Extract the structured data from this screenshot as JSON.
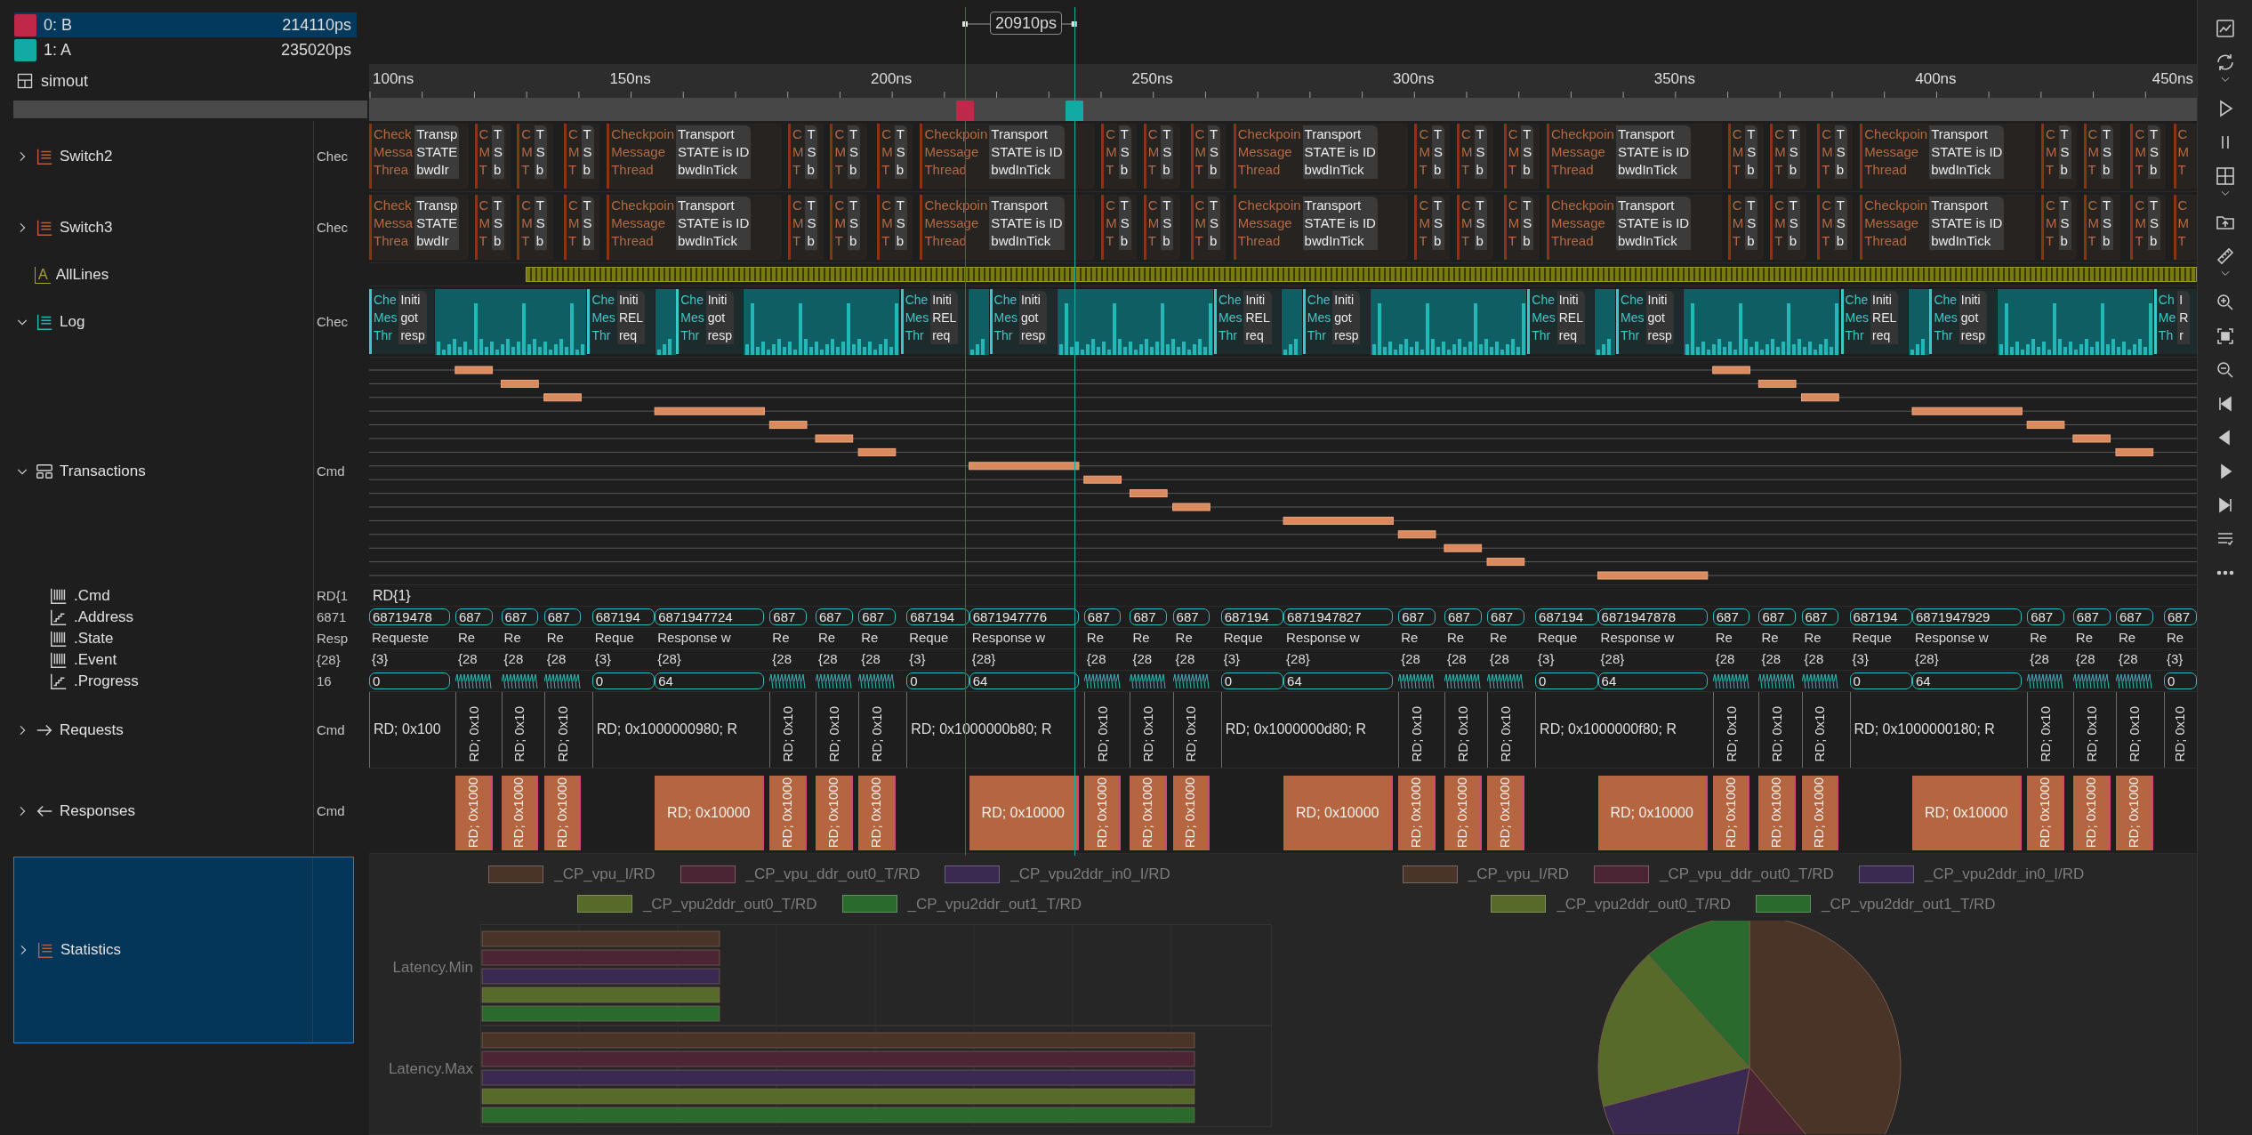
{
  "cursors": [
    {
      "label": "0: B",
      "time": "214110ps",
      "color": "#c0284a",
      "selected": true
    },
    {
      "label": "1: A",
      "time": "235020ps",
      "color": "#13aaa4",
      "selected": false
    }
  ],
  "delta": "20910ps",
  "view": {
    "title": "simout"
  },
  "ruler": [
    "100ns",
    "150ns",
    "200ns",
    "250ns",
    "300ns",
    "350ns",
    "400ns",
    "450ns"
  ],
  "tree": [
    {
      "label": "Switch2",
      "kind": "list",
      "color": "#b0603a",
      "expanded": false,
      "selected": false,
      "value": "Chec",
      "wave": {
        "kind": "blocks",
        "blocks": [
          {
            "left": [
              "Check",
              "Messa",
              "Threa"
            ],
            "right": [
              "Transp",
              "STATE",
              "bwdIr"
            ]
          },
          {
            "left": [
              "C",
              "M",
              "T"
            ],
            "right": [
              "T",
              "S",
              "b"
            ]
          },
          {
            "left": [
              "C",
              "M",
              "T"
            ],
            "right": [
              "T",
              "S",
              "b"
            ]
          },
          {
            "left": [
              "C",
              "M",
              "T"
            ],
            "right": [
              "T",
              "S",
              "b"
            ]
          },
          {
            "left": [
              "Checkpoin",
              "Message",
              "Thread"
            ],
            "right": [
              "Transport",
              "STATE is ID",
              "bwdInTick"
            ]
          },
          {
            "left": [
              "C",
              "M",
              "T"
            ],
            "right": [
              "T",
              "S",
              "b"
            ]
          },
          {
            "left": [
              "C",
              "M",
              "T"
            ],
            "right": [
              "T",
              "S",
              "b"
            ]
          },
          {
            "left": [
              "C",
              "M",
              "T"
            ],
            "right": [
              "T",
              "S",
              "b"
            ]
          },
          {
            "left": [
              "Checkpoin",
              "Message",
              "Thread"
            ],
            "right": [
              "Transport",
              "STATE is ID",
              "bwdInTick"
            ]
          },
          {
            "left": [
              "C",
              "M",
              "T"
            ],
            "right": [
              "T",
              "S",
              "b"
            ]
          },
          {
            "left": [
              "C",
              "M",
              "T"
            ],
            "right": [
              "T",
              "S",
              "b"
            ]
          },
          {
            "left": [
              "C",
              "M",
              "T"
            ],
            "right": [
              "T",
              "S",
              "b"
            ]
          },
          {
            "left": [
              "Checkpoin",
              "Message",
              "Thread"
            ],
            "right": [
              "Transport",
              "STATE is ID",
              "bwdInTick"
            ]
          },
          {
            "left": [
              "C",
              "M",
              "T"
            ],
            "right": [
              "T",
              "S",
              "b"
            ]
          },
          {
            "left": [
              "C",
              "M",
              "T"
            ],
            "right": [
              "T",
              "S",
              "b"
            ]
          },
          {
            "left": [
              "C",
              "M",
              "T"
            ],
            "right": [
              "T",
              "S",
              "b"
            ]
          },
          {
            "left": [
              "Checkpoin",
              "Message",
              "Thread"
            ],
            "right": [
              "Transport",
              "STATE is ID",
              "bwdInTick"
            ]
          },
          {
            "left": [
              "C",
              "M",
              "T"
            ],
            "right": [
              "T",
              "S",
              "b"
            ]
          },
          {
            "left": [
              "C",
              "M",
              "T"
            ],
            "right": [
              "T",
              "S",
              "b"
            ]
          },
          {
            "left": [
              "C",
              "M",
              "T"
            ],
            "right": [
              "T",
              "S",
              "b"
            ]
          },
          {
            "left": [
              "Checkpoin",
              "Message",
              "Thread"
            ],
            "right": [
              "Transport",
              "STATE is ID",
              "bwdInTick"
            ]
          },
          {
            "left": [
              "C",
              "M",
              "T"
            ],
            "right": [
              "T",
              "S",
              "b"
            ]
          },
          {
            "left": [
              "C",
              "M",
              "T"
            ],
            "right": [
              "T",
              "S",
              "b"
            ]
          },
          {
            "left": [
              "C",
              "M",
              "T"
            ],
            "right": [
              "T",
              "S",
              "b"
            ]
          },
          {
            "left": [
              "C",
              "M",
              "T"
            ]
          }
        ]
      }
    },
    {
      "label": "Switch3",
      "kind": "list",
      "color": "#b0603a",
      "expanded": false,
      "selected": false,
      "value": "Chec",
      "wave": {
        "kind": "blocks",
        "blocks": [
          {
            "left": [
              "Check",
              "Messa",
              "Threa"
            ],
            "right": [
              "Transp",
              "STATE",
              "bwdIr"
            ]
          },
          {
            "left": [
              "C",
              "M",
              "T"
            ],
            "right": [
              "T",
              "S",
              "b"
            ]
          },
          {
            "left": [
              "C",
              "M",
              "T"
            ],
            "right": [
              "T",
              "S",
              "b"
            ]
          },
          {
            "left": [
              "C",
              "M",
              "T"
            ],
            "right": [
              "T",
              "S",
              "b"
            ]
          },
          {
            "left": [
              "Checkpoin",
              "Message",
              "Thread"
            ],
            "right": [
              "Transport",
              "STATE is ID",
              "bwdInTick"
            ]
          },
          {
            "left": [
              "C",
              "M",
              "T"
            ],
            "right": [
              "T",
              "S",
              "b"
            ]
          },
          {
            "left": [
              "C",
              "M",
              "T"
            ],
            "right": [
              "T",
              "S",
              "b"
            ]
          },
          {
            "left": [
              "C",
              "M",
              "T"
            ],
            "right": [
              "T",
              "S",
              "b"
            ]
          },
          {
            "left": [
              "Checkpoin",
              "Message",
              "Thread"
            ],
            "right": [
              "Transport",
              "STATE is ID",
              "bwdInTick"
            ]
          },
          {
            "left": [
              "C",
              "M",
              "T"
            ],
            "right": [
              "T",
              "S",
              "b"
            ]
          },
          {
            "left": [
              "C",
              "M",
              "T"
            ],
            "right": [
              "T",
              "S",
              "b"
            ]
          },
          {
            "left": [
              "C",
              "M",
              "T"
            ],
            "right": [
              "T",
              "S",
              "b"
            ]
          },
          {
            "left": [
              "Checkpoin",
              "Message",
              "Thread"
            ],
            "right": [
              "Transport",
              "STATE is ID",
              "bwdInTick"
            ]
          },
          {
            "left": [
              "C",
              "M",
              "T"
            ],
            "right": [
              "T",
              "S",
              "b"
            ]
          },
          {
            "left": [
              "C",
              "M",
              "T"
            ],
            "right": [
              "T",
              "S",
              "b"
            ]
          },
          {
            "left": [
              "C",
              "M",
              "T"
            ],
            "right": [
              "T",
              "S",
              "b"
            ]
          },
          {
            "left": [
              "Checkpoin",
              "Message",
              "Thread"
            ],
            "right": [
              "Transport",
              "STATE is ID",
              "bwdInTick"
            ]
          },
          {
            "left": [
              "C",
              "M",
              "T"
            ],
            "right": [
              "T",
              "S",
              "b"
            ]
          },
          {
            "left": [
              "C",
              "M",
              "T"
            ],
            "right": [
              "T",
              "S",
              "b"
            ]
          },
          {
            "left": [
              "C",
              "M",
              "T"
            ],
            "right": [
              "T",
              "S",
              "b"
            ]
          },
          {
            "left": [
              "Checkpoin",
              "Message",
              "Thread"
            ],
            "right": [
              "Transport",
              "STATE is ID",
              "bwdInTick"
            ]
          },
          {
            "left": [
              "C",
              "M",
              "T"
            ],
            "right": [
              "T",
              "S",
              "b"
            ]
          },
          {
            "left": [
              "C",
              "M",
              "T"
            ],
            "right": [
              "T",
              "S",
              "b"
            ]
          },
          {
            "left": [
              "C",
              "M",
              "T"
            ],
            "right": [
              "T",
              "S",
              "b"
            ]
          },
          {
            "left": [
              "C",
              "M",
              "T"
            ]
          }
        ]
      }
    },
    {
      "label": "AllLines",
      "kind": "text",
      "badge": "A",
      "color": "#a8a030",
      "selected": false,
      "wave": {
        "kind": "density"
      }
    },
    {
      "label": "Log",
      "kind": "list",
      "color": "#22b8b8",
      "expanded": true,
      "selected": false,
      "value": "Chec",
      "wave": {
        "kind": "log",
        "blocks": [
          {
            "left": [
              "Che",
              "Mes",
              "Thr"
            ],
            "right": [
              "Initi",
              "got",
              "resp"
            ]
          },
          {
            "left": [
              "Che",
              "Mes",
              "Thr"
            ],
            "right": [
              "Initi",
              "REL",
              "req"
            ]
          },
          {
            "left": [
              "Che",
              "Mes",
              "Thr"
            ],
            "right": [
              "Initi",
              "got",
              "resp"
            ]
          },
          {
            "left": [
              "Che",
              "Mes",
              "Thr"
            ],
            "right": [
              "Initi",
              "REL",
              "req"
            ]
          },
          {
            "left": [
              "Che",
              "Mes",
              "Thr"
            ],
            "right": [
              "Initi",
              "got",
              "resp"
            ]
          },
          {
            "left": [
              "Che",
              "Mes",
              "Thr"
            ],
            "right": [
              "Initi",
              "REL",
              "req"
            ]
          },
          {
            "left": [
              "Che",
              "Mes",
              "Thr"
            ],
            "right": [
              "Initi",
              "got",
              "resp"
            ]
          },
          {
            "left": [
              "Che",
              "Mes",
              "Thr"
            ],
            "right": [
              "Initi",
              "REL",
              "req"
            ]
          },
          {
            "left": [
              "Che",
              "Mes",
              "Thr"
            ],
            "right": [
              "Initi",
              "got",
              "resp"
            ]
          },
          {
            "left": [
              "Che",
              "Mes",
              "Thr"
            ],
            "right": [
              "Initi",
              "REL",
              "req"
            ]
          },
          {
            "left": [
              "Che",
              "Mes",
              "Thr"
            ],
            "right": [
              "Initi",
              "got",
              "resp"
            ]
          },
          {
            "left": [
              "Ch",
              "Me",
              "Th"
            ],
            "right": [
              "I",
              "R",
              "r"
            ]
          }
        ]
      }
    },
    {
      "label": "Transactions",
      "kind": "transaction",
      "expanded": true,
      "selected": false,
      "value": "Cmd",
      "wave": {
        "kind": "lanes"
      },
      "children": [
        {
          "label": ".Cmd",
          "kind": "bars",
          "selected": false,
          "value": "RD{1",
          "wave": {
            "kind": "text",
            "text": "RD{1}"
          }
        },
        {
          "label": ".Address",
          "kind": "step",
          "selected": false,
          "value": "6871",
          "wave": {
            "kind": "bus",
            "items": [
              {
                "kind": "value",
                "text": "68719478"
              },
              {
                "kind": "value",
                "text": "687"
              },
              {
                "kind": "value",
                "text": "687"
              },
              {
                "kind": "value",
                "text": "687"
              },
              {
                "kind": "value",
                "text": "687194"
              },
              {
                "kind": "value",
                "text": "6871947724"
              },
              {
                "kind": "value",
                "text": "687"
              },
              {
                "kind": "value",
                "text": "687"
              },
              {
                "kind": "value",
                "text": "687"
              },
              {
                "kind": "value",
                "text": "687194"
              },
              {
                "kind": "value",
                "text": "6871947776"
              },
              {
                "kind": "value",
                "text": "687"
              },
              {
                "kind": "value",
                "text": "687"
              },
              {
                "kind": "value",
                "text": "687"
              },
              {
                "kind": "value",
                "text": "687194"
              },
              {
                "kind": "value",
                "text": "6871947827"
              },
              {
                "kind": "value",
                "text": "687"
              },
              {
                "kind": "value",
                "text": "687"
              },
              {
                "kind": "value",
                "text": "687"
              },
              {
                "kind": "value",
                "text": "687194"
              },
              {
                "kind": "value",
                "text": "6871947878"
              },
              {
                "kind": "value",
                "text": "687"
              },
              {
                "kind": "value",
                "text": "687"
              },
              {
                "kind": "value",
                "text": "687"
              },
              {
                "kind": "value",
                "text": "687194"
              },
              {
                "kind": "value",
                "text": "6871947929"
              },
              {
                "kind": "value",
                "text": "687"
              },
              {
                "kind": "value",
                "text": "687"
              },
              {
                "kind": "value",
                "text": "687"
              },
              {
                "kind": "value",
                "text": "687"
              }
            ]
          }
        },
        {
          "label": ".State",
          "kind": "bars",
          "selected": false,
          "value": "Resp",
          "wave": {
            "kind": "labels",
            "items": [
              "Requeste",
              "Re",
              "Re",
              "Re",
              "Reque",
              "Response w",
              "Re",
              "Re",
              "Re",
              "Reque",
              "Response w",
              "Re",
              "Re",
              "Re",
              "Reque",
              "Response w",
              "Re",
              "Re",
              "Re",
              "Reque",
              "Response w",
              "Re",
              "Re",
              "Re",
              "Reque",
              "Response w",
              "Re",
              "Re",
              "Re",
              "Re"
            ]
          }
        },
        {
          "label": ".Event",
          "kind": "bars",
          "selected": false,
          "value": "{28}",
          "wave": {
            "kind": "labels",
            "items": [
              "{3}",
              "{28",
              "{28",
              "{28",
              "{3}",
              "{28}",
              "{28",
              "{28",
              "{28",
              "{3}",
              "{28}",
              "{28",
              "{28",
              "{28",
              "{3}",
              "{28}",
              "{28",
              "{28",
              "{28",
              "{3}",
              "{28}",
              "{28",
              "{28",
              "{28",
              "{3}",
              "{28}",
              "{28",
              "{28",
              "{28",
              "{3}"
            ]
          }
        },
        {
          "label": ".Progress",
          "kind": "step",
          "selected": false,
          "value": "16",
          "wave": {
            "kind": "bus",
            "items": [
              {
                "kind": "value",
                "text": "0"
              },
              {
                "kind": "burst"
              },
              {
                "kind": "burst"
              },
              {
                "kind": "burst"
              },
              {
                "kind": "value",
                "text": "0"
              },
              {
                "kind": "value",
                "text": "64"
              },
              {
                "kind": "burst"
              },
              {
                "kind": "burst"
              },
              {
                "kind": "burst"
              },
              {
                "kind": "value",
                "text": "0"
              },
              {
                "kind": "value",
                "text": "64"
              },
              {
                "kind": "burst"
              },
              {
                "kind": "burst"
              },
              {
                "kind": "burst"
              },
              {
                "kind": "value",
                "text": "0"
              },
              {
                "kind": "value",
                "text": "64"
              },
              {
                "kind": "burst"
              },
              {
                "kind": "burst"
              },
              {
                "kind": "burst"
              },
              {
                "kind": "value",
                "text": "0"
              },
              {
                "kind": "value",
                "text": "64"
              },
              {
                "kind": "burst"
              },
              {
                "kind": "burst"
              },
              {
                "kind": "burst"
              },
              {
                "kind": "value",
                "text": "0"
              },
              {
                "kind": "value",
                "text": "64"
              },
              {
                "kind": "burst"
              },
              {
                "kind": "burst"
              },
              {
                "kind": "burst"
              },
              {
                "kind": "value",
                "text": "0"
              }
            ]
          }
        }
      ]
    },
    {
      "label": "Requests",
      "kind": "arrow-right",
      "expanded": false,
      "selected": false,
      "value": "Cmd",
      "wave": {
        "kind": "requests",
        "items": [
          {
            "kind": "wide",
            "text": "RD; 0x100"
          },
          {
            "kind": "narrow",
            "text": "RD; 0x10"
          },
          {
            "kind": "narrow",
            "text": "RD; 0x10"
          },
          {
            "kind": "narrow",
            "text": "RD; 0x10"
          },
          {
            "kind": "wide",
            "text": "RD; 0x1000000980; R"
          },
          {
            "kind": "narrow",
            "text": "RD; 0x10"
          },
          {
            "kind": "narrow",
            "text": "RD; 0x10"
          },
          {
            "kind": "narrow",
            "text": "RD; 0x10"
          },
          {
            "kind": "wide",
            "text": "RD; 0x1000000b80; R"
          },
          {
            "kind": "narrow",
            "text": "RD; 0x10"
          },
          {
            "kind": "narrow",
            "text": "RD; 0x10"
          },
          {
            "kind": "narrow",
            "text": "RD; 0x10"
          },
          {
            "kind": "wide",
            "text": "RD; 0x1000000d80; R"
          },
          {
            "kind": "narrow",
            "text": "RD; 0x10"
          },
          {
            "kind": "narrow",
            "text": "RD; 0x10"
          },
          {
            "kind": "narrow",
            "text": "RD; 0x10"
          },
          {
            "kind": "wide",
            "text": "RD; 0x1000000f80; R"
          },
          {
            "kind": "narrow",
            "text": "RD; 0x10"
          },
          {
            "kind": "narrow",
            "text": "RD; 0x10"
          },
          {
            "kind": "narrow",
            "text": "RD; 0x10"
          },
          {
            "kind": "wide",
            "text": "RD; 0x1000000180; R"
          },
          {
            "kind": "narrow",
            "text": "RD; 0x10"
          },
          {
            "kind": "narrow",
            "text": "RD; 0x10"
          },
          {
            "kind": "narrow",
            "text": "RD; 0x10"
          },
          {
            "kind": "narrow",
            "text": "RD; 0x10"
          }
        ]
      }
    },
    {
      "label": "Responses",
      "kind": "arrow-left",
      "expanded": false,
      "selected": false,
      "value": "Cmd",
      "wave": {
        "kind": "responses",
        "items": [
          {
            "kind": "narrow",
            "text": "RD; 0x1000"
          },
          {
            "kind": "narrow",
            "text": "RD; 0x1000"
          },
          {
            "kind": "narrow",
            "text": "RD; 0x1000"
          },
          {
            "kind": "wide",
            "text": "RD; 0x10000"
          },
          {
            "kind": "narrow",
            "text": "RD; 0x1000"
          },
          {
            "kind": "narrow",
            "text": "RD; 0x1000"
          },
          {
            "kind": "narrow",
            "text": "RD; 0x1000"
          },
          {
            "kind": "wide",
            "text": "RD; 0x10000"
          },
          {
            "kind": "narrow",
            "text": "RD; 0x1000"
          },
          {
            "kind": "narrow",
            "text": "RD; 0x1000"
          },
          {
            "kind": "narrow",
            "text": "RD; 0x1000"
          },
          {
            "kind": "wide",
            "text": "RD; 0x10000"
          },
          {
            "kind": "narrow",
            "text": "RD; 0x1000"
          },
          {
            "kind": "narrow",
            "text": "RD; 0x1000"
          },
          {
            "kind": "narrow",
            "text": "RD; 0x1000"
          },
          {
            "kind": "wide",
            "text": "RD; 0x10000"
          },
          {
            "kind": "narrow",
            "text": "RD; 0x1000"
          },
          {
            "kind": "narrow",
            "text": "RD; 0x1000"
          },
          {
            "kind": "narrow",
            "text": "RD; 0x1000"
          },
          {
            "kind": "wide",
            "text": "RD; 0x10000"
          },
          {
            "kind": "narrow",
            "text": "RD; 0x1000"
          },
          {
            "kind": "narrow",
            "text": "RD; 0x1000"
          },
          {
            "kind": "narrow",
            "text": "RD; 0x1000"
          }
        ]
      }
    },
    {
      "label": "Statistics",
      "kind": "list",
      "color": "#b0603a",
      "expanded": false,
      "selected": true,
      "wave": {
        "kind": "charts",
        "bars": {
          "categories": [
            "Latency.Min",
            "Latency.Max"
          ],
          "legend": [
            {
              "label": "_CP_vpu_I/RD",
              "color": "#4a3428"
            },
            {
              "label": "_CP_vpu_ddr_out0_T/RD",
              "color": "#4c2534"
            },
            {
              "label": "_CP_vpu2ddr_in0_I/RD",
              "color": "#3a2a52"
            },
            {
              "label": "_CP_vpu2ddr_out0_T/RD",
              "color": "#566a2a"
            },
            {
              "label": "_CP_vpu2ddr_out1_T/RD",
              "color": "#2a6a2c"
            }
          ]
        },
        "pie": {
          "legend": [
            {
              "label": "_CP_vpu_I/RD",
              "color": "#4a3428"
            },
            {
              "label": "_CP_vpu_ddr_out0_T/RD",
              "color": "#4c2534"
            },
            {
              "label": "_CP_vpu2ddr_in0_I/RD",
              "color": "#3a2a52"
            },
            {
              "label": "_CP_vpu2ddr_out0_T/RD",
              "color": "#566a2a"
            },
            {
              "label": "_CP_vpu2ddr_out1_T/RD",
              "color": "#2a6a2c"
            }
          ]
        }
      }
    }
  ]
}
